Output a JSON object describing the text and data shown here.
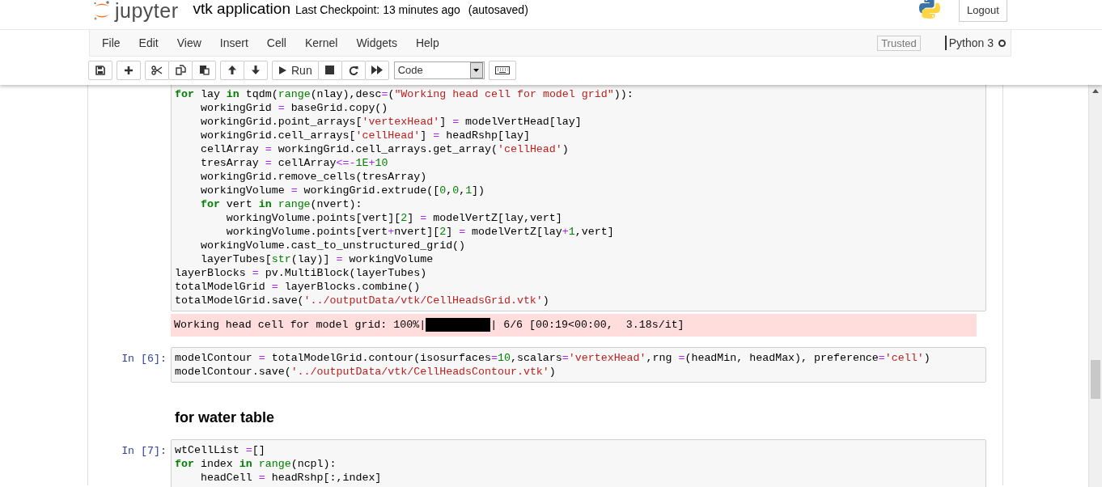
{
  "header": {
    "logo_text": "jupyter",
    "notebook_title": "vtk application",
    "checkpoint": "Last Checkpoint: 13 minutes ago",
    "autosave": "(autosaved)",
    "logout": "Logout"
  },
  "menu": [
    "File",
    "Edit",
    "View",
    "Insert",
    "Cell",
    "Kernel",
    "Widgets",
    "Help"
  ],
  "trusted": "Trusted",
  "kernel": {
    "name": "Python 3",
    "busy": false
  },
  "toolbar": {
    "run_label": "Run",
    "cell_type": "Code"
  },
  "cells": [
    {
      "kind": "code",
      "lines": [
        [
          {
            "kind": "keyword",
            "text": "for"
          },
          {
            "kind": "plain",
            "text": " lay "
          },
          {
            "kind": "keyword",
            "text": "in"
          },
          {
            "kind": "plain",
            "text": " tqdm("
          },
          {
            "kind": "builtin",
            "text": "range"
          },
          {
            "kind": "plain",
            "text": "(nlay),desc"
          },
          {
            "kind": "operator",
            "text": "="
          },
          {
            "kind": "plain",
            "text": "("
          },
          {
            "kind": "string",
            "text": "\"Working head cell for model grid\""
          },
          {
            "kind": "plain",
            "text": ")):"
          }
        ],
        [
          {
            "kind": "plain",
            "text": "    workingGrid "
          },
          {
            "kind": "operator",
            "text": "="
          },
          {
            "kind": "plain",
            "text": " baseGrid.copy()"
          }
        ],
        [
          {
            "kind": "plain",
            "text": "    workingGrid.point_arrays["
          },
          {
            "kind": "string",
            "text": "'vertexHead'"
          },
          {
            "kind": "plain",
            "text": "] "
          },
          {
            "kind": "operator",
            "text": "="
          },
          {
            "kind": "plain",
            "text": " modelVertHead[lay]"
          }
        ],
        [
          {
            "kind": "plain",
            "text": "    workingGrid.cell_arrays["
          },
          {
            "kind": "string",
            "text": "'cellHead'"
          },
          {
            "kind": "plain",
            "text": "] "
          },
          {
            "kind": "operator",
            "text": "="
          },
          {
            "kind": "plain",
            "text": " headRshp[lay]"
          }
        ],
        [
          {
            "kind": "plain",
            "text": "    cellArray "
          },
          {
            "kind": "operator",
            "text": "="
          },
          {
            "kind": "plain",
            "text": " workingGrid.cell_arrays.get_array("
          },
          {
            "kind": "string",
            "text": "'cellHead'"
          },
          {
            "kind": "plain",
            "text": ")"
          }
        ],
        [
          {
            "kind": "plain",
            "text": "    tresArray "
          },
          {
            "kind": "operator",
            "text": "="
          },
          {
            "kind": "plain",
            "text": " cellArray"
          },
          {
            "kind": "operator",
            "text": "<=-"
          },
          {
            "kind": "number",
            "text": "1E"
          },
          {
            "kind": "operator",
            "text": "+"
          },
          {
            "kind": "number",
            "text": "10"
          }
        ],
        [
          {
            "kind": "plain",
            "text": "    workingGrid.remove_cells(tresArray)"
          }
        ],
        [
          {
            "kind": "plain",
            "text": "    workingVolume "
          },
          {
            "kind": "operator",
            "text": "="
          },
          {
            "kind": "plain",
            "text": " workingGrid.extrude(["
          },
          {
            "kind": "number",
            "text": "0"
          },
          {
            "kind": "plain",
            "text": ","
          },
          {
            "kind": "number",
            "text": "0"
          },
          {
            "kind": "plain",
            "text": ","
          },
          {
            "kind": "number",
            "text": "1"
          },
          {
            "kind": "plain",
            "text": "])"
          }
        ],
        [
          {
            "kind": "keyword",
            "text": "    for"
          },
          {
            "kind": "plain",
            "text": " vert "
          },
          {
            "kind": "keyword",
            "text": "in"
          },
          {
            "kind": "builtin",
            "text": " range"
          },
          {
            "kind": "plain",
            "text": "(nvert):"
          }
        ],
        [
          {
            "kind": "plain",
            "text": "        workingVolume.points[vert]["
          },
          {
            "kind": "number",
            "text": "2"
          },
          {
            "kind": "plain",
            "text": "] "
          },
          {
            "kind": "operator",
            "text": "="
          },
          {
            "kind": "plain",
            "text": " modelVertZ[lay,vert]"
          }
        ],
        [
          {
            "kind": "plain",
            "text": "        workingVolume.points[vert"
          },
          {
            "kind": "operator",
            "text": "+"
          },
          {
            "kind": "plain",
            "text": "nvert]["
          },
          {
            "kind": "number",
            "text": "2"
          },
          {
            "kind": "plain",
            "text": "] "
          },
          {
            "kind": "operator",
            "text": "="
          },
          {
            "kind": "plain",
            "text": " modelVertZ[lay"
          },
          {
            "kind": "operator",
            "text": "+"
          },
          {
            "kind": "number",
            "text": "1"
          },
          {
            "kind": "plain",
            "text": ",vert]"
          }
        ],
        [
          {
            "kind": "plain",
            "text": "    workingVolume.cast_to_unstructured_grid()"
          }
        ],
        [
          {
            "kind": "plain",
            "text": "    layerTubes["
          },
          {
            "kind": "builtin",
            "text": "str"
          },
          {
            "kind": "plain",
            "text": "(lay)] "
          },
          {
            "kind": "operator",
            "text": "="
          },
          {
            "kind": "plain",
            "text": " workingVolume"
          }
        ],
        [
          {
            "kind": "plain",
            "text": "layerBlocks "
          },
          {
            "kind": "operator",
            "text": "="
          },
          {
            "kind": "plain",
            "text": " pv.MultiBlock(layerTubes)"
          }
        ],
        [
          {
            "kind": "plain",
            "text": "totalModelGrid "
          },
          {
            "kind": "operator",
            "text": "="
          },
          {
            "kind": "plain",
            "text": " layerBlocks.combine()"
          }
        ],
        [
          {
            "kind": "plain",
            "text": "totalModelGrid.save("
          },
          {
            "kind": "string",
            "text": "'../outputData/vtk/CellHeadsGrid.vtk'"
          },
          {
            "kind": "plain",
            "text": ")"
          }
        ]
      ],
      "output": {
        "kind": "stderr",
        "prefix": "Working head cell for model grid: 100%|",
        "level": 1,
        "suffix": "| 6/6 [00:19<00:00,  3.18s/it]"
      }
    },
    {
      "kind": "code",
      "prompt": "In [6]:",
      "lines": [
        [
          {
            "kind": "plain",
            "text": "modelContour "
          },
          {
            "kind": "operator",
            "text": "="
          },
          {
            "kind": "plain",
            "text": " totalModelGrid.contour(isosurfaces"
          },
          {
            "kind": "operator",
            "text": "="
          },
          {
            "kind": "number",
            "text": "10"
          },
          {
            "kind": "plain",
            "text": ",scalars"
          },
          {
            "kind": "operator",
            "text": "="
          },
          {
            "kind": "string",
            "text": "'vertexHead'"
          },
          {
            "kind": "plain",
            "text": ",rng "
          },
          {
            "kind": "operator",
            "text": "="
          },
          {
            "kind": "plain",
            "text": "(headMin, headMax), preference"
          },
          {
            "kind": "operator",
            "text": "="
          },
          {
            "kind": "string",
            "text": "'cell'"
          },
          {
            "kind": "plain",
            "text": ")"
          }
        ],
        [
          {
            "kind": "plain",
            "text": "modelContour.save("
          },
          {
            "kind": "string",
            "text": "'../outputData/vtk/CellHeadsContour.vtk'"
          },
          {
            "kind": "plain",
            "text": ")"
          }
        ]
      ]
    },
    {
      "kind": "markdown",
      "heading": "for water table"
    },
    {
      "kind": "code",
      "prompt": "In [7]:",
      "lines": [
        [
          {
            "kind": "plain",
            "text": "wtCellList "
          },
          {
            "kind": "operator",
            "text": "="
          },
          {
            "kind": "plain",
            "text": "[]"
          }
        ],
        [
          {
            "kind": "keyword",
            "text": "for"
          },
          {
            "kind": "plain",
            "text": " index "
          },
          {
            "kind": "keyword",
            "text": "in"
          },
          {
            "kind": "builtin",
            "text": " range"
          },
          {
            "kind": "plain",
            "text": "(ncpl):"
          }
        ],
        [
          {
            "kind": "plain",
            "text": "    headCell "
          },
          {
            "kind": "operator",
            "text": "="
          },
          {
            "kind": "plain",
            "text": " headRshp[:,index]"
          }
        ]
      ]
    }
  ]
}
